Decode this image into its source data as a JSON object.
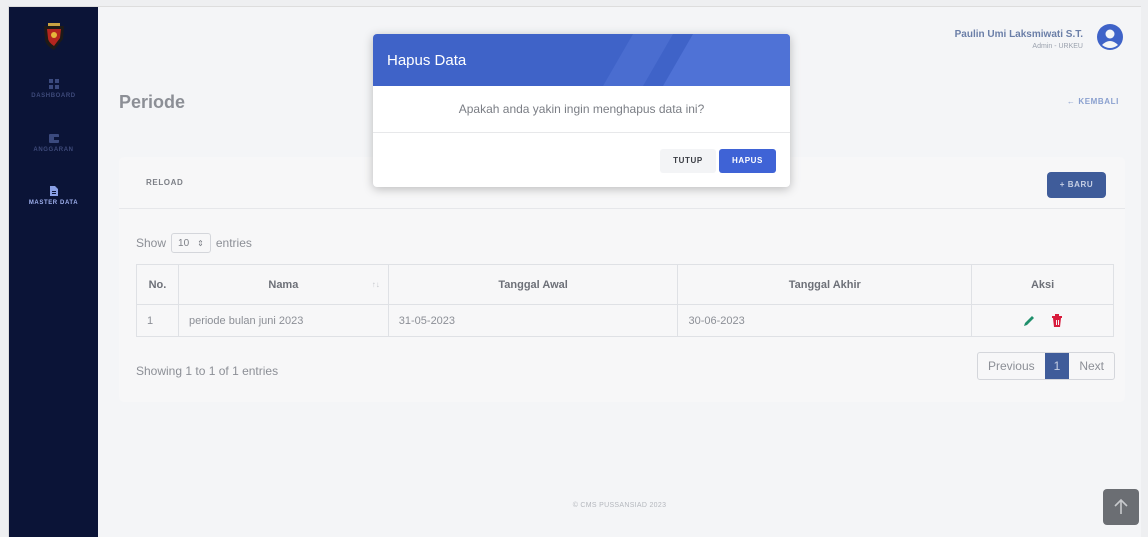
{
  "sidebar": {
    "items": [
      {
        "label": "DASHBOARD",
        "icon": "grid-icon"
      },
      {
        "label": "ANGGARAN",
        "icon": "wallet-icon"
      },
      {
        "label": "MASTER DATA",
        "icon": "document-icon"
      }
    ]
  },
  "header": {
    "user_name": "Paulin Umi Laksmiwati S.T.",
    "user_role": "Admin - URKEU"
  },
  "page": {
    "title": "Periode",
    "back_label": "← KEMBALI"
  },
  "card": {
    "reload_label": "RELOAD",
    "new_label": "+ BARU",
    "show_label": "Show",
    "entries_label": "entries",
    "page_size": "10",
    "table": {
      "headers": [
        "No.",
        "Nama",
        "Tanggal Awal",
        "Tanggal Akhir",
        "Aksi"
      ],
      "rows": [
        {
          "no": "1",
          "nama": "periode bulan juni 2023",
          "awal": "31-05-2023",
          "akhir": "30-06-2023"
        }
      ]
    },
    "showing_text": "Showing 1 to 1 of 1 entries",
    "pagination": {
      "previous": "Previous",
      "current": "1",
      "next": "Next"
    }
  },
  "footer": {
    "text": "© CMS PUSSANSIAD 2023"
  },
  "modal": {
    "title": "Hapus Data",
    "message": "Apakah anda yakin ingin menghapus data ini?",
    "cancel_label": "TUTUP",
    "confirm_label": "HAPUS"
  },
  "colors": {
    "sidebar": "#0b1437",
    "modal_header": "#3f63c8",
    "primary_button": "#3f63d6",
    "edit_icon": "#1f8f6b",
    "delete_icon": "#d81b3c"
  }
}
